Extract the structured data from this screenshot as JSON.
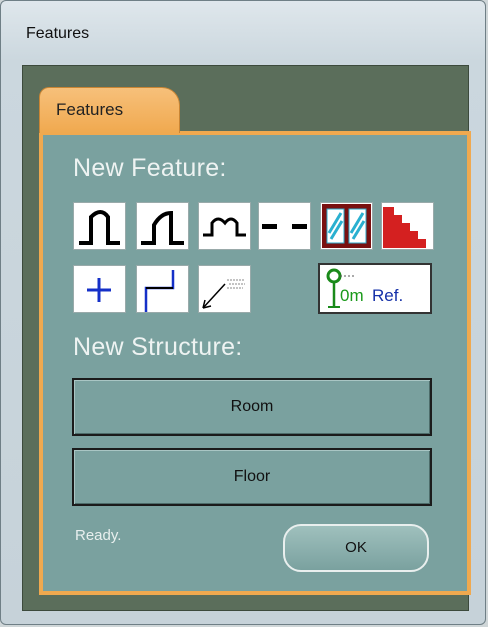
{
  "window": {
    "title": "Features"
  },
  "tab": {
    "label": "Features"
  },
  "sections": {
    "new_feature": "New Feature:",
    "new_structure": "New Structure:"
  },
  "feature_tools": [
    {
      "icon": "door-arc-icon"
    },
    {
      "icon": "door-swing-icon"
    },
    {
      "icon": "double-door-icon"
    },
    {
      "icon": "dashed-wall-icon"
    },
    {
      "icon": "window-icon"
    },
    {
      "icon": "stairs-icon"
    },
    {
      "icon": "plus-icon"
    },
    {
      "icon": "corner-icon"
    },
    {
      "icon": "dimension-arrow-icon"
    },
    {
      "icon": "reference-point-icon",
      "text": "0m",
      "label": "Ref."
    }
  ],
  "buttons": {
    "room": "Room",
    "floor": "Floor",
    "ok": "OK"
  },
  "status": "Ready.",
  "colors": {
    "panel": "#7aa19f",
    "tab": "#f0a94f",
    "frame": "#5b6e5b"
  }
}
